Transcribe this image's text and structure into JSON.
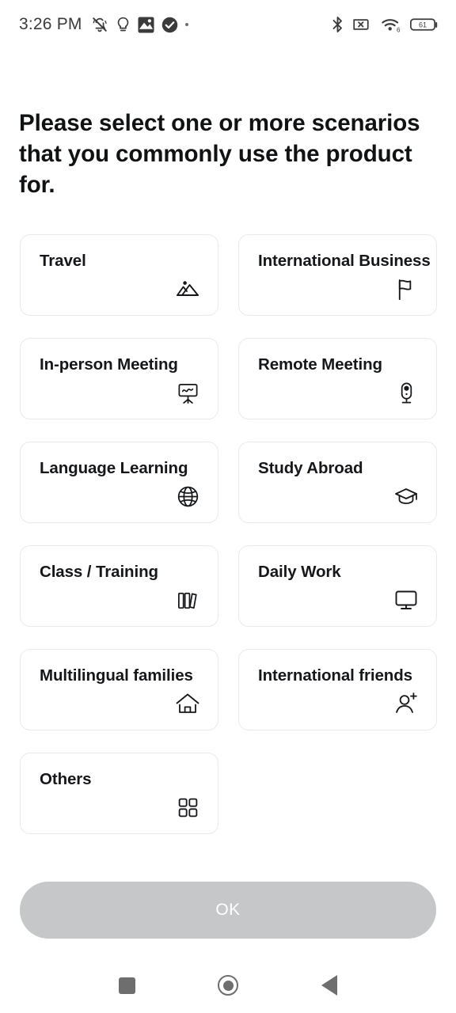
{
  "statusbar": {
    "time": "3:26 PM",
    "left_icons": [
      {
        "name": "bell-muted-icon"
      },
      {
        "name": "lightbulb-icon"
      },
      {
        "name": "photo-icon"
      },
      {
        "name": "check-circle-icon"
      },
      {
        "name": "more-dot-icon"
      }
    ],
    "right_icons": [
      {
        "name": "bluetooth-icon"
      },
      {
        "name": "no-sim-icon"
      },
      {
        "name": "wifi-6-icon",
        "label": "6"
      },
      {
        "name": "battery-icon",
        "label": "61"
      }
    ],
    "battery_level": "61"
  },
  "heading": "Please select one or more scenarios that you commonly use the product for.",
  "cards": [
    {
      "label": "Travel",
      "icon": "mountains-icon"
    },
    {
      "label": "International Business",
      "icon": "flag-icon"
    },
    {
      "label": "In-person Meeting",
      "icon": "presentation-board-icon"
    },
    {
      "label": "Remote Meeting",
      "icon": "webcam-icon"
    },
    {
      "label": "Language Learning",
      "icon": "globe-icon"
    },
    {
      "label": "Study Abroad",
      "icon": "graduation-cap-icon"
    },
    {
      "label": "Class / Training",
      "icon": "books-icon"
    },
    {
      "label": "Daily Work",
      "icon": "monitor-icon"
    },
    {
      "label": "Multilingual families",
      "icon": "home-icon"
    },
    {
      "label": "International friends",
      "icon": "add-person-icon"
    },
    {
      "label": "Others",
      "icon": "grid-squares-icon"
    }
  ],
  "confirm_button": {
    "label": "OK",
    "enabled": false,
    "background_color": "#c5c7c9",
    "text_color": "#ffffff"
  },
  "navbar": {
    "recents_label": "Recents",
    "home_label": "Home",
    "back_label": "Back"
  },
  "colors": {
    "background": "#ffffff",
    "card_border": "#e9eaeb",
    "text_primary": "#16171a",
    "nav_icon": "#6e6e6e"
  }
}
